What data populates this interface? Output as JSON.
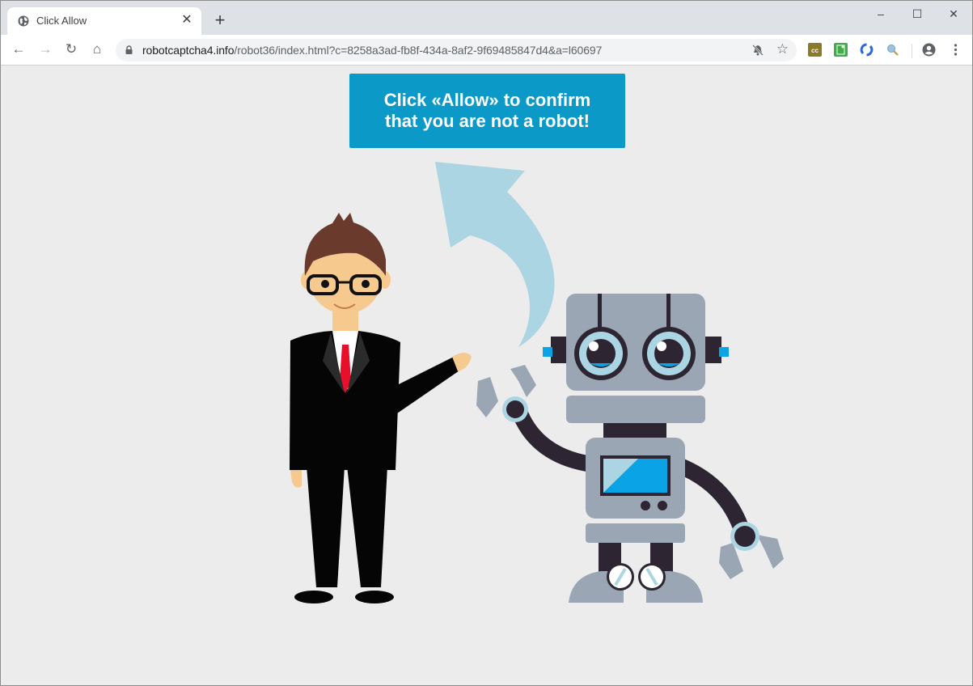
{
  "browser": {
    "tab": {
      "title": "Click Allow",
      "icon": "globe-icon"
    },
    "new_tab_label": "+",
    "window_controls": {
      "minimize": "–",
      "maximize": "☐",
      "close": "✕"
    },
    "nav": {
      "back": "←",
      "forward": "→",
      "reload": "↻",
      "home": "⌂"
    },
    "address": {
      "host": "robotcaptcha4.info",
      "path": "/robot36/index.html?c=8258a3ad-fb8f-434a-8af2-9f69485847d4&a=l60697"
    },
    "omnibox_icons": [
      "lock-icon",
      "notifications-blocked-icon",
      "bookmark-star-icon"
    ],
    "extensions": [
      {
        "name": "cc-extension-icon",
        "color": "#8a7a2a"
      },
      {
        "name": "green-extension-icon",
        "color": "#3fae49"
      },
      {
        "name": "sync-extension-icon",
        "color": "#2a6ad8"
      },
      {
        "name": "search-extension-icon",
        "color": "#6fa0c8"
      }
    ],
    "profile_icon": "account-circle-icon",
    "menu_icon": "more-vert-icon"
  },
  "page": {
    "cta_line1": "Click «Allow» to confirm",
    "cta_line2": "that you are not a robot!",
    "colors": {
      "background": "#ececec",
      "cta": "#0b99c7",
      "arrow": "#acd5e3",
      "robot_gray": "#9aa6b4",
      "robot_dark": "#2e2532",
      "robot_blue": "#0aa3e6"
    },
    "illustration": [
      "businessman",
      "curved-arrow",
      "robot"
    ]
  }
}
